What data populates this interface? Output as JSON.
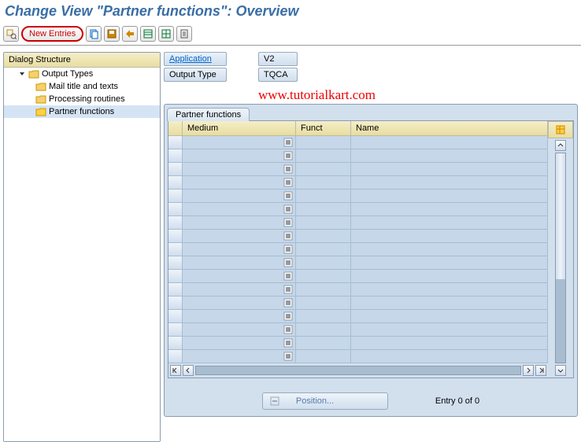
{
  "title": "Change View \"Partner functions\": Overview",
  "toolbar": {
    "new_entries": "New Entries",
    "icons": [
      "pencil-magnify-icon",
      "copy-icon",
      "save-icon",
      "undo-icon",
      "select-all-icon",
      "grid-icon",
      "doc-icon"
    ]
  },
  "tree": {
    "header": "Dialog Structure",
    "items": [
      {
        "label": "Output Types",
        "level": 1,
        "selected": false,
        "open": true
      },
      {
        "label": "Mail title and texts",
        "level": 2,
        "selected": false
      },
      {
        "label": "Processing routines",
        "level": 2,
        "selected": false
      },
      {
        "label": "Partner functions",
        "level": 2,
        "selected": true
      }
    ]
  },
  "fields": {
    "application": {
      "label": "Application",
      "value": "V2",
      "highlighted": true
    },
    "output_type": {
      "label": "Output Type",
      "value": "TQCA",
      "highlighted": false
    }
  },
  "watermark": "www.tutorialkart.com",
  "grid": {
    "tab": "Partner functions",
    "columns": [
      "Medium",
      "Funct",
      "Name"
    ],
    "row_count": 17
  },
  "footer": {
    "position_btn": "Position...",
    "entry": "Entry 0 of 0"
  }
}
